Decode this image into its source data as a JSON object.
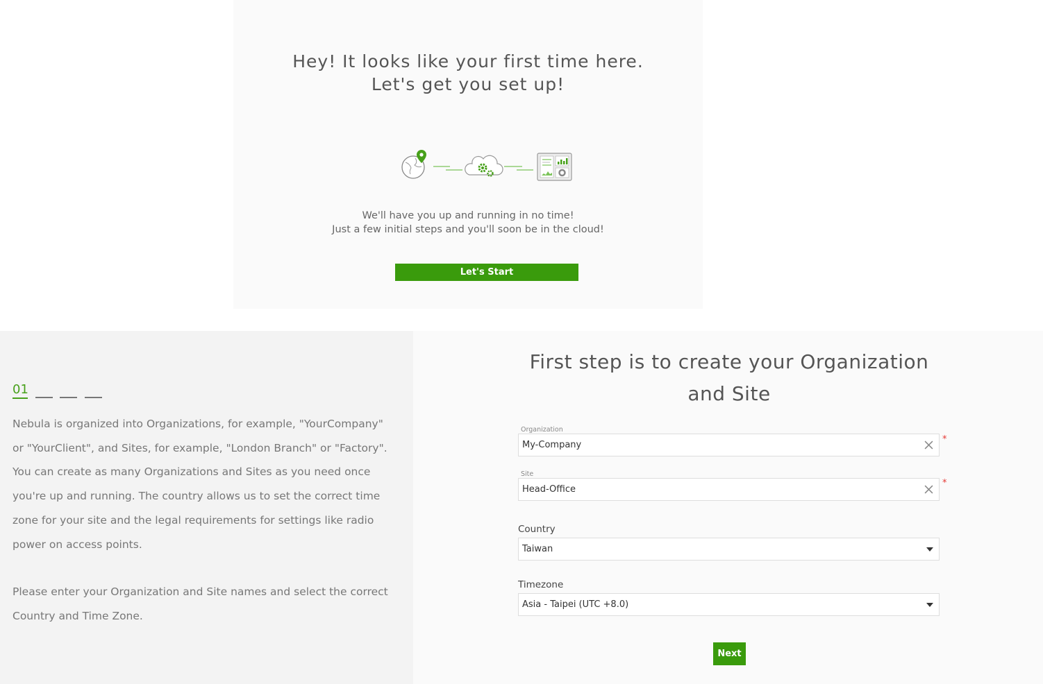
{
  "welcome": {
    "heading_line1": "Hey! It looks like your first time here.",
    "heading_line2": "Let's get you set up!",
    "subtext_line1": "We'll have you up and running in no time!",
    "subtext_line2": "Just a few initial steps and you'll soon be in the cloud!",
    "start_button": "Let's Start",
    "icons": [
      "globe-location-icon",
      "cloud-gears-icon",
      "dashboard-icon"
    ],
    "accent_color": "#3a9b0c"
  },
  "steps": {
    "current": "01",
    "total": 4
  },
  "description": {
    "paragraph1": "Nebula is organized into Organizations, for example, \"YourCompany\" or \"YourClient\", and Sites, for example, \"London Branch\" or \"Factory\". You can create as many Organizations and Sites as you need once you're up and running. The country allows us to set the correct time zone for your site and the legal requirements for settings like radio power on access points.",
    "paragraph2": "Please enter your Organization and Site names and select the correct Country and Time Zone."
  },
  "form": {
    "title": "First step is to create your Organization and Site",
    "organization": {
      "label": "Organization",
      "value": "My-Company",
      "required_mark": "*"
    },
    "site": {
      "label": "Site",
      "value": "Head-Office",
      "required_mark": "*"
    },
    "country": {
      "label": "Country",
      "value": "Taiwan"
    },
    "timezone": {
      "label": "Timezone",
      "value": "Asia - Taipei (UTC +8.0)"
    },
    "next_button": "Next"
  }
}
